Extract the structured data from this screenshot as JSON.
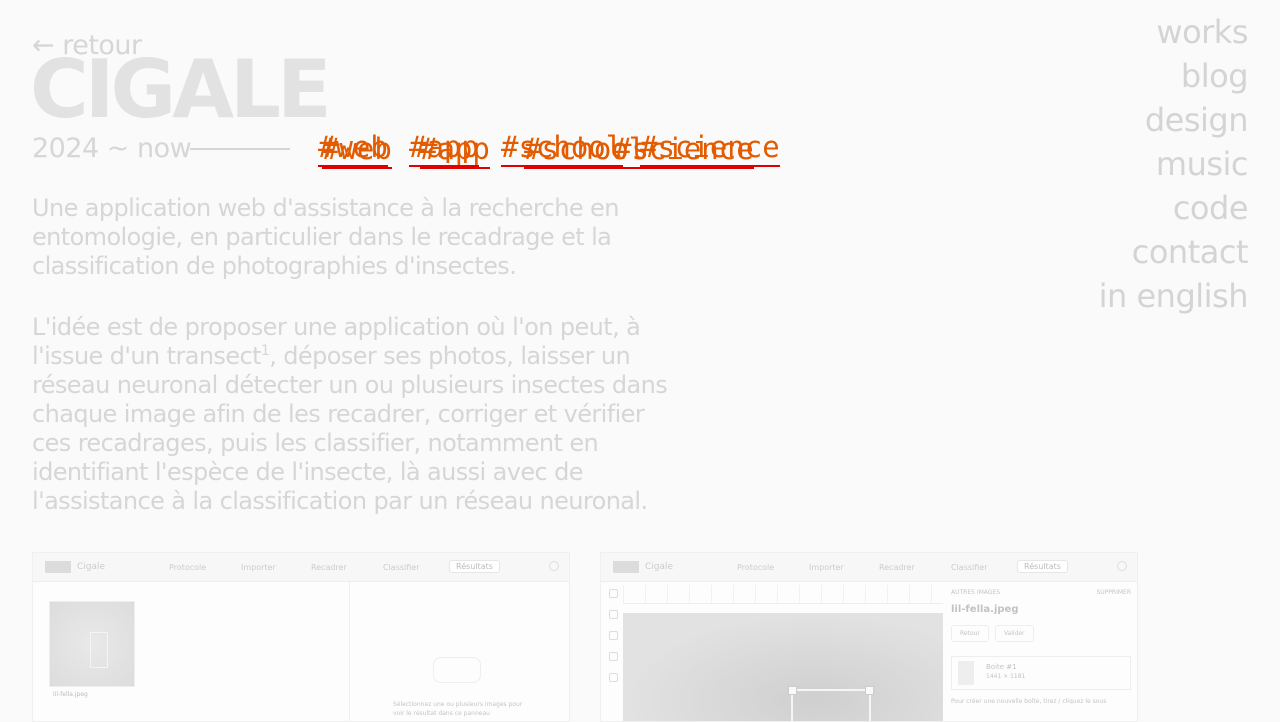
{
  "back_label": "← retour",
  "title": "CIGALE",
  "period": "2024 ~ now",
  "tags": [
    "#web",
    "#app",
    "#school",
    "#science",
    "#web",
    "#app",
    "#school",
    "#science"
  ],
  "nav": [
    "works",
    "blog",
    "design",
    "music",
    "code",
    "contact",
    "in english"
  ],
  "description_1": "Une application web d'assistance à la recherche en entomologie, en particulier dans le recadrage et la classification de photographies d'insectes.",
  "description_2": {
    "before": "L'idée est de proposer une application où l'on peut, à l'issue d'un transect",
    "footnote": "1",
    "after": ", déposer ses photos, laisser un réseau neuronal détecter un ou plusieurs insectes dans chaque image afin de les recadrer, corriger et vérifier ces recadrages, puis les classifier, notamment en identifiant l'espèce de l'insecte, là aussi avec de l'assistance à la classification par un réseau neuronal."
  },
  "screenshots": {
    "app_name": "Cigale",
    "steps": [
      "Protocole",
      "Importer",
      "Recadrer",
      "Classifier",
      "Résultats"
    ],
    "shot1": {
      "thumb_caption": "lil-fella.jpeg",
      "drop_text": "Sélectionnez une ou plusieurs images pour voir le résultat dans ce panneau"
    },
    "shot2": {
      "panel_header": "AUTRES IMAGES",
      "panel_delete": "SUPPRIMER",
      "file_name": "lil-fella.jpeg",
      "btn_prev": "Retour",
      "btn_validate": "Valider",
      "item_title": "Boite #1",
      "item_size": "1441 × 1181",
      "hint": "Pour créer une nouvelle boîte, tirez / cliquez le sous"
    }
  }
}
